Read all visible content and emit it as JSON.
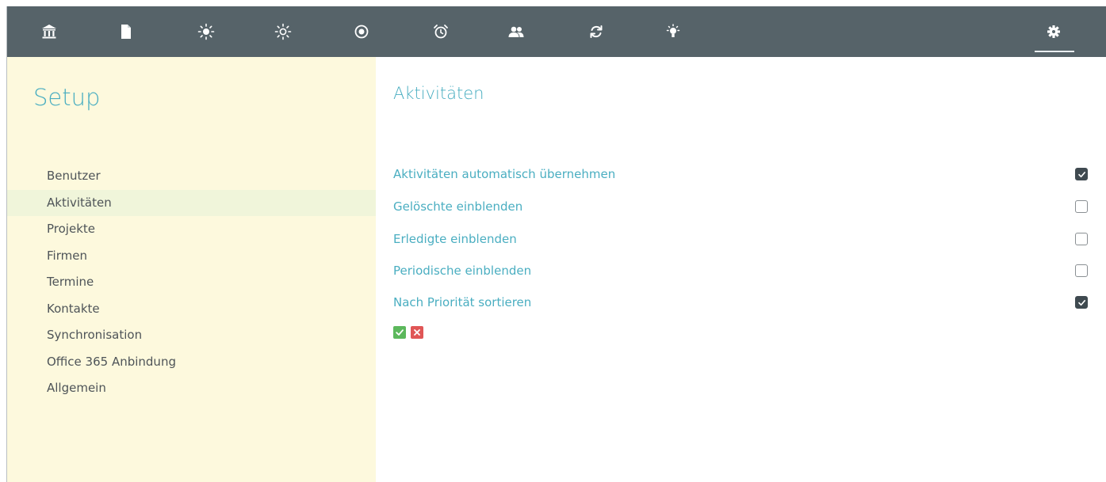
{
  "toolbar": {
    "icons": [
      "bank-icon",
      "document-icon",
      "sun-icon",
      "sun-outline-icon",
      "target-icon",
      "alarm-clock-icon",
      "people-icon",
      "refresh-icon",
      "lightbulb-icon",
      "gear-icon"
    ],
    "active_icon": "gear-icon",
    "background": "#566369"
  },
  "sidebar": {
    "title": "Setup",
    "items": [
      {
        "label": "Benutzer",
        "active": false
      },
      {
        "label": "Aktivitäten",
        "active": true
      },
      {
        "label": "Projekte",
        "active": false
      },
      {
        "label": "Firmen",
        "active": false
      },
      {
        "label": "Termine",
        "active": false
      },
      {
        "label": "Kontakte",
        "active": false
      },
      {
        "label": "Synchronisation",
        "active": false
      },
      {
        "label": "Office 365 Anbindung",
        "active": false
      },
      {
        "label": "Allgemein",
        "active": false
      }
    ],
    "background": "#fdf9dd",
    "active_background": "#f0f5da"
  },
  "main": {
    "title": "Aktivitäten",
    "options": [
      {
        "label": "Aktivitäten automatisch übernehmen",
        "checked": true
      },
      {
        "label": "Gelöschte einblenden",
        "checked": false
      },
      {
        "label": "Erledigte einblenden",
        "checked": false
      },
      {
        "label": "Periodische einblenden",
        "checked": false
      },
      {
        "label": "Nach Priorität sortieren",
        "checked": true
      }
    ],
    "actions": {
      "save_icon": "check-icon",
      "cancel_icon": "x-icon"
    }
  },
  "colors": {
    "accent": "#4aaec1",
    "ok": "#5cb85c",
    "cancel": "#e05656"
  }
}
